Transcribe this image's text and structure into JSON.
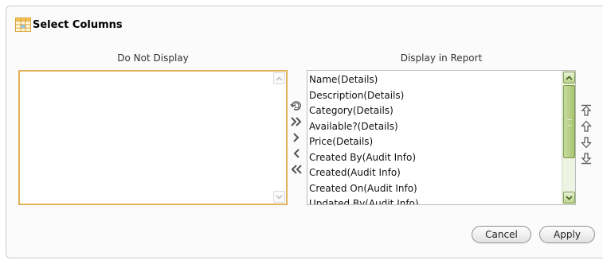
{
  "header": {
    "icon": "table-grid-icon",
    "title": "Select Columns"
  },
  "columns": {
    "left_heading": "Do Not Display",
    "right_heading": "Display in Report"
  },
  "left_list": {
    "items": []
  },
  "right_list": {
    "items": [
      "Name(Details)",
      "Description(Details)",
      "Category(Details)",
      "Available?(Details)",
      "Price(Details)",
      "Created By(Audit Info)",
      "Created(Audit Info)",
      "Created On(Audit Info)",
      "Updated By(Audit Info)"
    ]
  },
  "shuttle_controls": [
    {
      "name": "reset-icon",
      "action": "Reset"
    },
    {
      "name": "move-all-icon",
      "action": "Move All"
    },
    {
      "name": "move-icon",
      "action": "Move"
    },
    {
      "name": "remove-icon",
      "action": "Remove"
    },
    {
      "name": "remove-all-icon",
      "action": "Remove All"
    }
  ],
  "order_controls": [
    {
      "name": "move-top-icon",
      "action": "Top"
    },
    {
      "name": "move-up-icon",
      "action": "Up"
    },
    {
      "name": "move-down-icon",
      "action": "Down"
    },
    {
      "name": "move-bottom-icon",
      "action": "Bottom"
    }
  ],
  "buttons": {
    "cancel_label": "Cancel",
    "apply_label": "Apply"
  },
  "colors": {
    "focus_border": "#e1b25a",
    "scroll_accent": "#a9c572",
    "panel_border": "#c9c9c9"
  }
}
